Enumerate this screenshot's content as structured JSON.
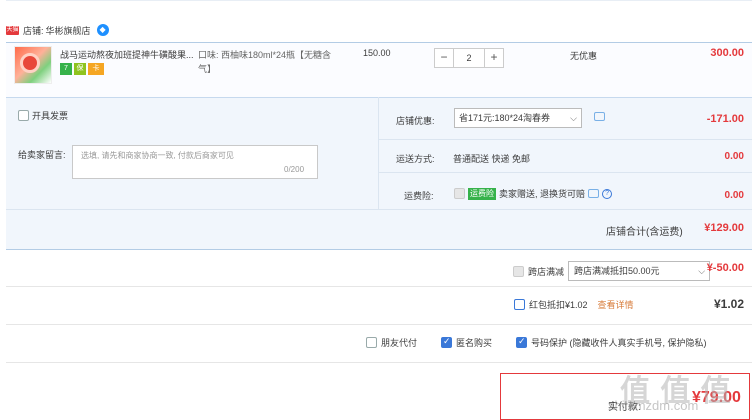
{
  "shop": {
    "tmall_icon": "天猫",
    "label": "店铺:",
    "name": "华彬旗舰店",
    "ww_icon": "ww-chat-icon"
  },
  "item": {
    "title": "战马运动熬夜加班提神牛磺酸果...",
    "badges": [
      "7",
      "保",
      "卡"
    ],
    "sku": "口味: 西柚味180ml*24瓶【无糖含气】",
    "unit_price": "150.00",
    "quantity": "2",
    "qty_minus": "−",
    "qty_plus": "+",
    "discount": "无优惠",
    "total": "300.00"
  },
  "order": {
    "invoice_label": "开具发票",
    "message_label": "给卖家留言:",
    "message_placeholder": "选填, 请先和商家协商一致, 付款后商家可见",
    "message_count": "0/200",
    "shop_discount_label": "店铺优惠:",
    "coupon_selected": "省171元:180*24淘春券",
    "shop_discount_value": "-171.00",
    "shipping_label": "运送方式:",
    "shipping_value": "普通配送 快递 免邮",
    "shipping_price": "0.00",
    "insurance_label": "运费险:",
    "insurance_tag": "运费险",
    "insurance_text": "卖家赠送, 退换货可赔",
    "insurance_price": "0.00",
    "shop_total_label": "店铺合计(含运费)",
    "shop_total_value": "¥129.00"
  },
  "cross": {
    "label": "跨店满减",
    "selected": "跨店满减抵扣50.00元",
    "value": "¥-50.00"
  },
  "redpacket": {
    "label": "红包抵扣¥1.02",
    "link": "查看详情",
    "value": "¥1.02"
  },
  "options": {
    "friend_pay": "朋友代付",
    "anonymous": "匿名购买",
    "privacy": "号码保护 (隐藏收件人真实手机号, 保护隐私)"
  },
  "payment": {
    "label": "实付款:",
    "value": "¥79.00"
  },
  "watermark": {
    "logo": "值 值 值",
    "url": "zhi.smzdm.com"
  }
}
